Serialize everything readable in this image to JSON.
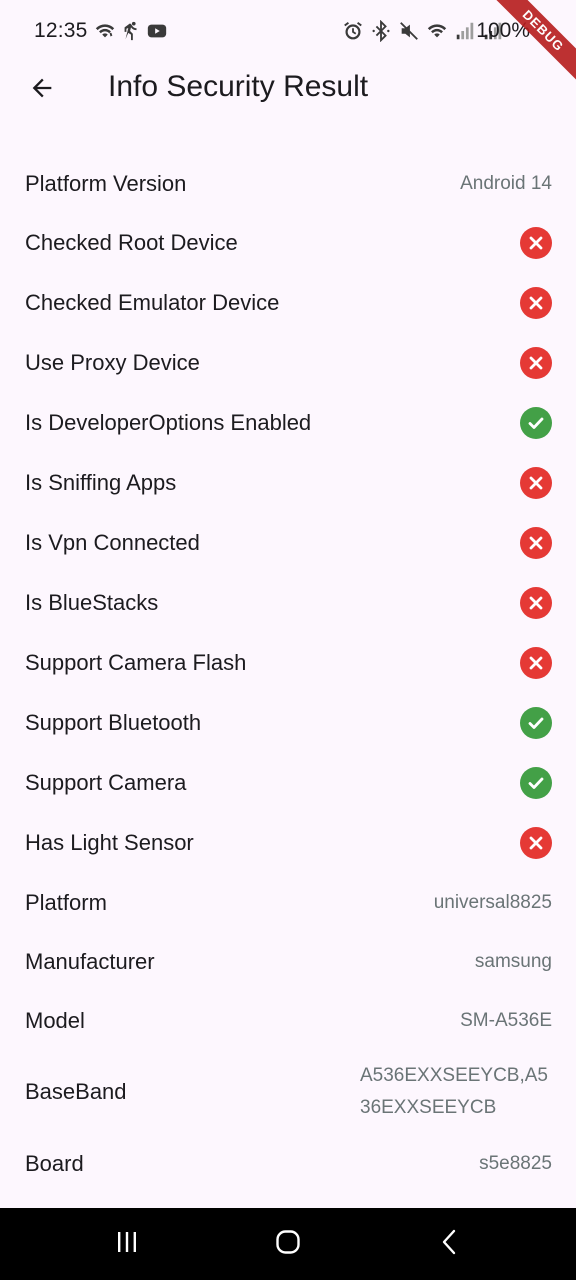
{
  "status_bar": {
    "time": "12:35",
    "battery": "100%",
    "left_icons": [
      "wifi-calling-icon",
      "running-icon",
      "youtube-icon"
    ],
    "right_icons": [
      "alarm-icon",
      "bluetooth-icon",
      "mute-icon",
      "wifi-icon",
      "signal-icon",
      "signal-icon"
    ]
  },
  "debug_banner": "DEBUG",
  "app_bar": {
    "back_icon": "arrow-left-icon",
    "title": "Info Security Result"
  },
  "rows": [
    {
      "label": "Platform Version",
      "kind": "text",
      "value": "Android 14"
    },
    {
      "label": "Checked Root Device",
      "kind": "check",
      "status": false
    },
    {
      "label": "Checked Emulator Device",
      "kind": "check",
      "status": false
    },
    {
      "label": "Use Proxy Device",
      "kind": "check",
      "status": false
    },
    {
      "label": "Is DeveloperOptions Enabled",
      "kind": "check",
      "status": true
    },
    {
      "label": "Is Sniffing Apps",
      "kind": "check",
      "status": false
    },
    {
      "label": "Is Vpn Connected",
      "kind": "check",
      "status": false
    },
    {
      "label": "Is BlueStacks",
      "kind": "check",
      "status": false
    },
    {
      "label": "Support Camera Flash",
      "kind": "check",
      "status": false
    },
    {
      "label": "Support Bluetooth",
      "kind": "check",
      "status": true
    },
    {
      "label": "Support Camera",
      "kind": "check",
      "status": true
    },
    {
      "label": "Has Light Sensor",
      "kind": "check",
      "status": false
    },
    {
      "label": "Platform",
      "kind": "text",
      "value": "universal8825"
    },
    {
      "label": "Manufacturer",
      "kind": "text",
      "value": "samsung"
    },
    {
      "label": "Model",
      "kind": "text",
      "value": "SM-A536E"
    },
    {
      "label": "BaseBand",
      "kind": "text",
      "value": "A536EXXSEEYCB,A536EXXSEEYCB",
      "wrap": true
    },
    {
      "label": "Board",
      "kind": "text",
      "value": "s5e8825"
    }
  ],
  "colors": {
    "background": "#fdf7fe",
    "success": "#43a047",
    "error": "#e53935",
    "value_text": "#6a7476",
    "debug": "#b71c1c"
  },
  "nav_bar": {
    "items": [
      "recents-icon",
      "home-icon",
      "back-icon"
    ]
  }
}
